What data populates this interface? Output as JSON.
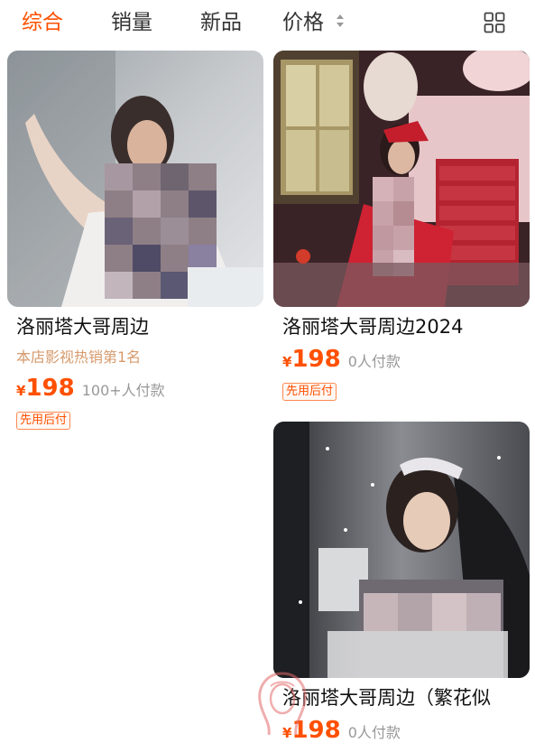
{
  "sort_bar": {
    "tabs": [
      {
        "label": "综合",
        "active": true
      },
      {
        "label": "销量",
        "active": false
      },
      {
        "label": "新品",
        "active": false
      },
      {
        "label": "价格",
        "active": false
      }
    ],
    "price_sort_icon": "sort-updown-icon",
    "layout_toggle_icon": "grid-view-icon"
  },
  "products": [
    {
      "title": "洛丽塔大哥周边",
      "rank_text": "本店影视热销第1名",
      "currency": "¥",
      "price": "198",
      "sales": "100+人付款",
      "tag": "先用后付"
    },
    {
      "title": "洛丽塔大哥周边2024",
      "rank_text": "",
      "currency": "¥",
      "price": "198",
      "sales": "0人付款",
      "tag": "先用后付"
    },
    {
      "title": "洛丽塔大哥周边（繁花似",
      "rank_text": "",
      "currency": "¥",
      "price": "198",
      "sales": "0人付款",
      "tag": ""
    }
  ],
  "colors": {
    "accent": "#ff5000",
    "rank_text": "#d59a6c",
    "muted_text": "#999999",
    "title_text": "#111111"
  }
}
